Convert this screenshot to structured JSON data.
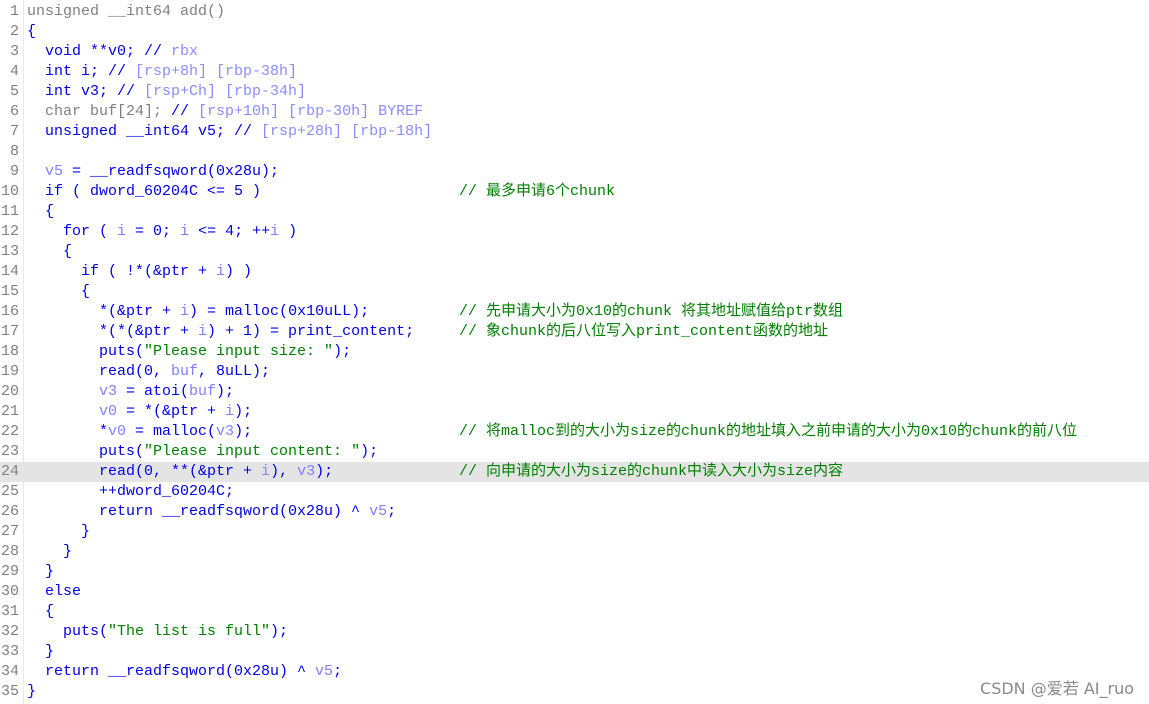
{
  "colors": {
    "default": "#0000e6",
    "gray": "#808080",
    "variable": "#8080ff",
    "offset_comment": "#8c8cff",
    "string": "#008000",
    "comment": "#008000",
    "highlight_bg": "#e4e4e4"
  },
  "highlighted_line": 24,
  "lines": [
    {
      "n": "1",
      "tokens": [
        [
          "g",
          "unsigned __int64 add()"
        ]
      ]
    },
    {
      "n": "2",
      "tokens": [
        [
          "k",
          "{"
        ]
      ]
    },
    {
      "n": "3",
      "tokens": [
        [
          "k",
          "  void **v0; // "
        ],
        [
          "o",
          "rbx"
        ]
      ]
    },
    {
      "n": "4",
      "tokens": [
        [
          "k",
          "  int i; // "
        ],
        [
          "o",
          "[rsp+8h] [rbp-38h]"
        ]
      ]
    },
    {
      "n": "5",
      "tokens": [
        [
          "k",
          "  int v3; // "
        ],
        [
          "o",
          "[rsp+Ch] [rbp-34h]"
        ]
      ]
    },
    {
      "n": "6",
      "tokens": [
        [
          "g",
          "  char buf[24]; "
        ],
        [
          "k",
          "// "
        ],
        [
          "o",
          "[rsp+10h] [rbp-30h] BYREF"
        ]
      ]
    },
    {
      "n": "7",
      "tokens": [
        [
          "k",
          "  unsigned __int64 v5; // "
        ],
        [
          "o",
          "[rsp+28h] [rbp-18h]"
        ]
      ]
    },
    {
      "n": "8",
      "tokens": []
    },
    {
      "n": "9",
      "tokens": [
        [
          "v",
          "  v5"
        ],
        [
          "k",
          " = __readfsqword(0x28u);"
        ]
      ]
    },
    {
      "n": "10",
      "tokens": [
        [
          "k",
          "  if ( dword_60204C <= 5 )"
        ]
      ],
      "comment": "// 最多申请6个chunk"
    },
    {
      "n": "11",
      "tokens": [
        [
          "k",
          "  {"
        ]
      ]
    },
    {
      "n": "12",
      "tokens": [
        [
          "k",
          "    for ( "
        ],
        [
          "v",
          "i"
        ],
        [
          "k",
          " = 0; "
        ],
        [
          "v",
          "i"
        ],
        [
          "k",
          " <= 4; ++"
        ],
        [
          "v",
          "i"
        ],
        [
          "k",
          " )"
        ]
      ]
    },
    {
      "n": "13",
      "tokens": [
        [
          "k",
          "    {"
        ]
      ]
    },
    {
      "n": "14",
      "tokens": [
        [
          "k",
          "      if ( !*(&ptr + "
        ],
        [
          "v",
          "i"
        ],
        [
          "k",
          ") )"
        ]
      ]
    },
    {
      "n": "15",
      "tokens": [
        [
          "k",
          "      {"
        ]
      ]
    },
    {
      "n": "16",
      "tokens": [
        [
          "k",
          "        *(&ptr + "
        ],
        [
          "v",
          "i"
        ],
        [
          "k",
          ") = malloc(0x10uLL);"
        ]
      ],
      "comment": "// 先申请大小为0x10的chunk 将其地址赋值给ptr数组"
    },
    {
      "n": "17",
      "tokens": [
        [
          "k",
          "        *(*(&ptr + "
        ],
        [
          "v",
          "i"
        ],
        [
          "k",
          ") + 1) = print_content;"
        ]
      ],
      "comment": "// 象chunk的后八位写入print_content函数的地址"
    },
    {
      "n": "18",
      "tokens": [
        [
          "k",
          "        puts("
        ],
        [
          "s",
          "\"Please input size: \""
        ],
        [
          "k",
          ");"
        ]
      ]
    },
    {
      "n": "19",
      "tokens": [
        [
          "k",
          "        read(0, "
        ],
        [
          "v",
          "buf"
        ],
        [
          "k",
          ", 8uLL);"
        ]
      ]
    },
    {
      "n": "20",
      "tokens": [
        [
          "v",
          "        v3"
        ],
        [
          "k",
          " = atoi("
        ],
        [
          "v",
          "buf"
        ],
        [
          "k",
          ");"
        ]
      ]
    },
    {
      "n": "21",
      "tokens": [
        [
          "v",
          "        v0"
        ],
        [
          "k",
          " = *(&ptr + "
        ],
        [
          "v",
          "i"
        ],
        [
          "k",
          ");"
        ]
      ]
    },
    {
      "n": "22",
      "tokens": [
        [
          "k",
          "        *"
        ],
        [
          "v",
          "v0"
        ],
        [
          "k",
          " = malloc("
        ],
        [
          "v",
          "v3"
        ],
        [
          "k",
          ");"
        ]
      ],
      "comment": "// 将malloc到的大小为size的chunk的地址填入之前申请的大小为0x10的chunk的前八位"
    },
    {
      "n": "23",
      "tokens": [
        [
          "k",
          "        puts("
        ],
        [
          "s",
          "\"Please input content: \""
        ],
        [
          "k",
          ");"
        ]
      ]
    },
    {
      "n": "24",
      "tokens": [
        [
          "k",
          "        read(0, **(&ptr + "
        ],
        [
          "v",
          "i"
        ],
        [
          "k",
          "), "
        ],
        [
          "v",
          "v3"
        ],
        [
          "k",
          ");"
        ]
      ],
      "comment": "// 向申请的大小为size的chunk中读入大小为size内容"
    },
    {
      "n": "25",
      "tokens": [
        [
          "k",
          "        ++dword_60204C;"
        ]
      ]
    },
    {
      "n": "26",
      "tokens": [
        [
          "k",
          "        return __readfsqword(0x28u) ^ "
        ],
        [
          "v",
          "v5"
        ],
        [
          "k",
          ";"
        ]
      ]
    },
    {
      "n": "27",
      "tokens": [
        [
          "k",
          "      }"
        ]
      ]
    },
    {
      "n": "28",
      "tokens": [
        [
          "k",
          "    }"
        ]
      ]
    },
    {
      "n": "29",
      "tokens": [
        [
          "k",
          "  }"
        ]
      ]
    },
    {
      "n": "30",
      "tokens": [
        [
          "k",
          "  else"
        ]
      ]
    },
    {
      "n": "31",
      "tokens": [
        [
          "k",
          "  {"
        ]
      ]
    },
    {
      "n": "32",
      "tokens": [
        [
          "k",
          "    puts("
        ],
        [
          "s",
          "\"The list is full\""
        ],
        [
          "k",
          ");"
        ]
      ]
    },
    {
      "n": "33",
      "tokens": [
        [
          "k",
          "  }"
        ]
      ]
    },
    {
      "n": "34",
      "tokens": [
        [
          "k",
          "  return __readfsqword(0x28u) ^ "
        ],
        [
          "v",
          "v5"
        ],
        [
          "k",
          ";"
        ]
      ]
    },
    {
      "n": "35",
      "tokens": [
        [
          "k",
          "}"
        ]
      ]
    }
  ],
  "watermark": "CSDN @爱若 AI_ruo"
}
